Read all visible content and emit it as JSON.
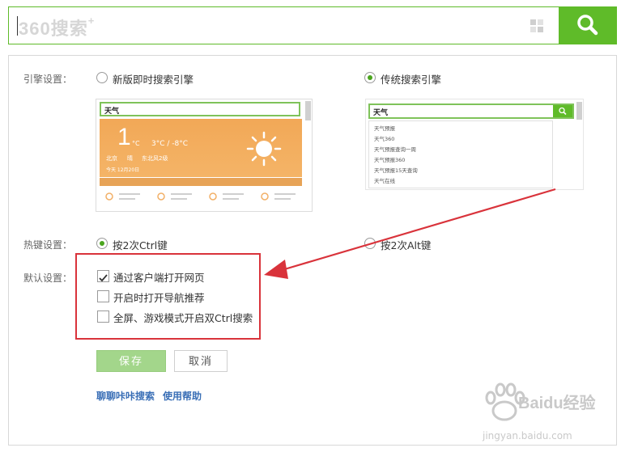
{
  "search": {
    "logo": "360搜索",
    "logo_plus": "+",
    "value": ""
  },
  "settings": {
    "engine_label": "引擎设置：",
    "engine_options": [
      "新版即时搜索引擎",
      "传统搜索引擎"
    ],
    "engine_selected": "传统搜索引擎",
    "hotkey_label": "热键设置：",
    "hotkey_options": [
      "按2次Ctrl键",
      "按2次Alt键"
    ],
    "hotkey_selected": "按2次Ctrl键",
    "default_label": "默认设置：",
    "default_checkboxes": [
      {
        "label": "通过客户端打开网页",
        "checked": true
      },
      {
        "label": "开启时打开导航推荐",
        "checked": false
      },
      {
        "label": "全屏、游戏模式开启双Ctrl搜索",
        "checked": false
      }
    ]
  },
  "preview_new": {
    "query": "天气",
    "temp": "1",
    "unit": "°C",
    "range": "3°C / -8°C",
    "city": "北京",
    "weather": "晴",
    "wind": "东北风2级",
    "date": "今天 12月20日"
  },
  "preview_classic": {
    "query": "天气",
    "suggestions": [
      "天气预报",
      "天气360",
      "天气预报查询一周",
      "天气预报360",
      "天气预报15天查询",
      "天气在线"
    ]
  },
  "buttons": {
    "save": "保存",
    "cancel": "取消"
  },
  "links": {
    "chat": "聊聊咔咔搜索",
    "help": "使用帮助"
  },
  "watermark": {
    "brand": "Baidu经验",
    "url": "jingyan.baidu.com"
  },
  "colors": {
    "accent": "#5fbb29",
    "highlight": "#d9333b",
    "save_button": "#a3d68b",
    "link": "#3a6fb6"
  }
}
